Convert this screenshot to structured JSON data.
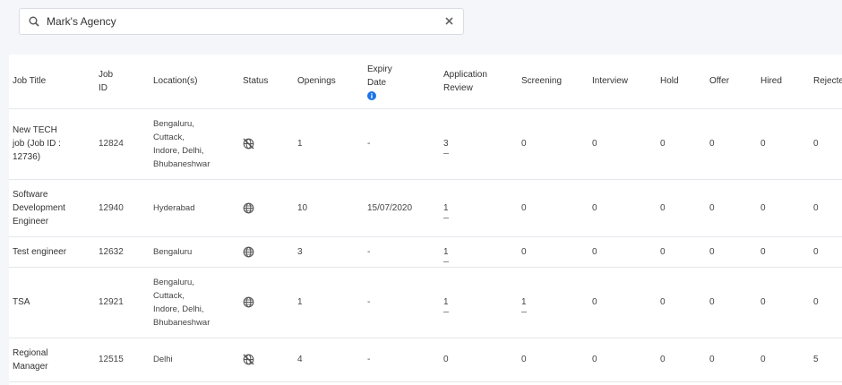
{
  "search": {
    "value": "Mark's Agency",
    "icon": "search-icon",
    "clear_icon": "close-icon"
  },
  "columns": {
    "job_title": "Job Title",
    "job_id_1": "Job",
    "job_id_2": "ID",
    "locations": "Location(s)",
    "status": "Status",
    "openings": "Openings",
    "expiry_1": "Expiry",
    "expiry_2": "Date",
    "app_review_1": "Application",
    "app_review_2": "Review",
    "screening": "Screening",
    "interview": "Interview",
    "hold": "Hold",
    "offer": "Offer",
    "hired": "Hired",
    "rejected": "Rejected"
  },
  "rows": [
    {
      "title": [
        "New TECH",
        "job (Job ID :",
        "12736)"
      ],
      "job_id": "12824",
      "locations": [
        "Bengaluru,",
        "Cuttack,",
        "Indore, Delhi,",
        "Bhubaneshwar"
      ],
      "status": "unpublished",
      "openings": "1",
      "expiry": "-",
      "app_review": "3",
      "app_review_link": true,
      "screening": "0",
      "screening_link": false,
      "interview": "0",
      "hold": "0",
      "offer": "0",
      "hired": "0",
      "rejected": "0",
      "height": 79
    },
    {
      "title": [
        "Software",
        "Development",
        "Engineer"
      ],
      "job_id": "12940",
      "locations": [
        "Hyderabad"
      ],
      "status": "published",
      "openings": "10",
      "expiry": "15/07/2020",
      "app_review": "1",
      "app_review_link": true,
      "screening": "0",
      "screening_link": false,
      "interview": "0",
      "hold": "0",
      "offer": "0",
      "hired": "0",
      "rejected": "0",
      "height": 64
    },
    {
      "title": [
        "Test engineer"
      ],
      "job_id": "12632",
      "locations": [
        "Bengaluru"
      ],
      "status": "published",
      "openings": "3",
      "expiry": "-",
      "app_review": "1",
      "app_review_link": true,
      "screening": "0",
      "screening_link": false,
      "interview": "0",
      "hold": "0",
      "offer": "0",
      "hired": "0",
      "rejected": "0",
      "height": 34
    },
    {
      "title": [
        "TSA"
      ],
      "job_id": "12921",
      "locations": [
        "Bengaluru,",
        "Cuttack,",
        "Indore, Delhi,",
        "Bhubaneshwar"
      ],
      "status": "published",
      "openings": "1",
      "expiry": "-",
      "app_review": "1",
      "app_review_link": true,
      "screening": "1",
      "screening_link": true,
      "interview": "0",
      "hold": "0",
      "offer": "0",
      "hired": "0",
      "rejected": "0",
      "height": 79
    },
    {
      "title": [
        "Regional",
        "Manager"
      ],
      "job_id": "12515",
      "locations": [
        "Delhi"
      ],
      "status": "unpublished",
      "openings": "4",
      "expiry": "-",
      "app_review": "0",
      "app_review_link": false,
      "screening": "0",
      "screening_link": false,
      "interview": "0",
      "hold": "0",
      "offer": "0",
      "hired": "0",
      "rejected": "5",
      "height": 49
    }
  ],
  "colors": {
    "info": "#1a73e8",
    "border": "#e4e7eb",
    "background": "#f4f6f9"
  }
}
